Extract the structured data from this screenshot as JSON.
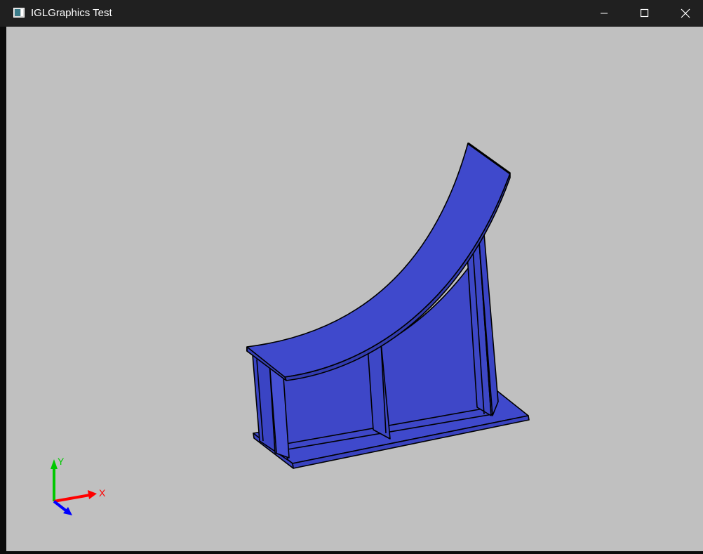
{
  "window": {
    "title": "IGLGraphics Test",
    "icon": "app-window-icon",
    "controls": {
      "minimize_icon": "minimize-icon",
      "maximize_icon": "maximize-icon",
      "close_icon": "close-icon"
    }
  },
  "viewport": {
    "background_color": "#c0c0c0",
    "model": {
      "color": "#3f49cc",
      "edge_color": "#000000"
    },
    "axis_gizmo": {
      "x_label": "X",
      "y_label": "Y",
      "x_color": "#ff0000",
      "y_color": "#00c800",
      "z_color": "#0000ff"
    }
  }
}
